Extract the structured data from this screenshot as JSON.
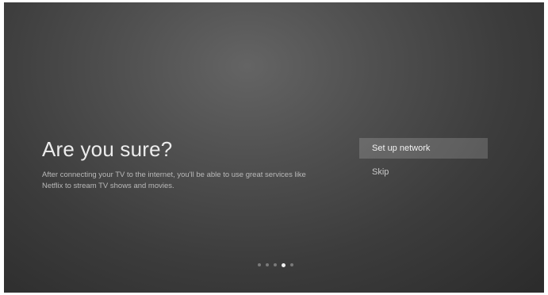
{
  "screen": {
    "title": "Are you sure?",
    "description": "After connecting your TV to the internet, you'll be able to use great services like Netflix to stream TV shows and movies."
  },
  "menu": {
    "items": [
      {
        "label": "Set up network",
        "selected": true
      },
      {
        "label": "Skip",
        "selected": false
      }
    ]
  },
  "pagination": {
    "total_steps": 5,
    "current_step": 4
  },
  "colors": {
    "background_dark": "#2b2b2b",
    "background_light": "#646464",
    "highlight": "rgba(255,255,255,0.17)",
    "text_primary": "#ececec",
    "text_secondary": "#b9b9b9"
  }
}
